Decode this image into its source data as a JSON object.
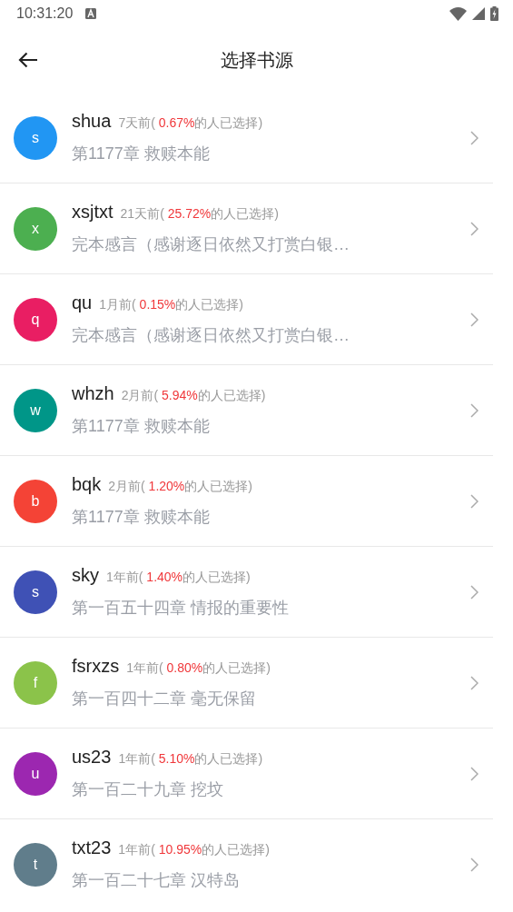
{
  "status_bar": {
    "time": "10:31:20"
  },
  "header": {
    "title": "选择书源"
  },
  "sources": [
    {
      "initial": "s",
      "color": "#2196f3",
      "name": "shua",
      "age": "7天前(",
      "percent": "0.67%",
      "suffix": "的人已选择)",
      "chapter": "第1177章 救赎本能"
    },
    {
      "initial": "x",
      "color": "#4caf50",
      "name": "xsjtxt",
      "age": "21天前(",
      "percent": "25.72%",
      "suffix": "的人已选择)",
      "chapter": "完本感言（感谢逐日依然又打赏白银…"
    },
    {
      "initial": "q",
      "color": "#e91e63",
      "name": "qu",
      "age": "1月前(",
      "percent": "0.15%",
      "suffix": "的人已选择)",
      "chapter": "完本感言（感谢逐日依然又打赏白银…"
    },
    {
      "initial": "w",
      "color": "#009688",
      "name": "whzh",
      "age": "2月前(",
      "percent": "5.94%",
      "suffix": "的人已选择)",
      "chapter": "第1177章 救赎本能"
    },
    {
      "initial": "b",
      "color": "#f44336",
      "name": "bqk",
      "age": "2月前(",
      "percent": "1.20%",
      "suffix": "的人已选择)",
      "chapter": "第1177章 救赎本能"
    },
    {
      "initial": "s",
      "color": "#3f51b5",
      "name": "sky",
      "age": "1年前(",
      "percent": "1.40%",
      "suffix": "的人已选择)",
      "chapter": "第一百五十四章 情报的重要性"
    },
    {
      "initial": "f",
      "color": "#8bc34a",
      "name": "fsrxzs",
      "age": "1年前(",
      "percent": "0.80%",
      "suffix": "的人已选择)",
      "chapter": "第一百四十二章 毫无保留"
    },
    {
      "initial": "u",
      "color": "#9c27b0",
      "name": "us23",
      "age": "1年前(",
      "percent": "5.10%",
      "suffix": "的人已选择)",
      "chapter": "第一百二十九章 挖坟"
    },
    {
      "initial": "t",
      "color": "#607d8b",
      "name": "txt23",
      "age": "1年前(",
      "percent": "10.95%",
      "suffix": "的人已选择)",
      "chapter": "第一百二十七章 汉特岛"
    }
  ]
}
